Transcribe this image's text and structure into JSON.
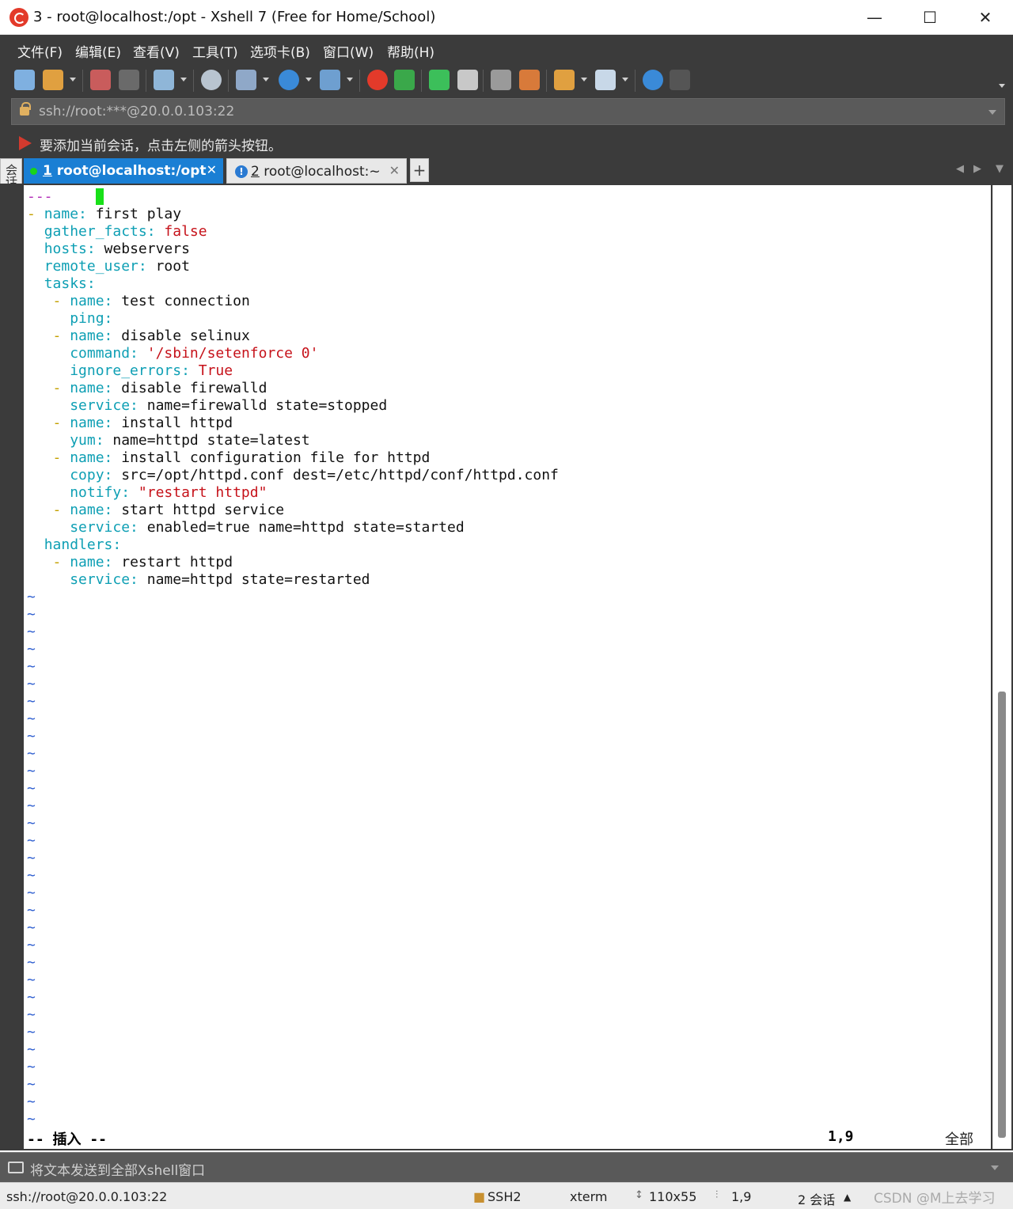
{
  "window": {
    "title": "3 - root@localhost:/opt - Xshell 7 (Free for Home/School)",
    "minimize": "—",
    "maximize": "☐",
    "close": "✕"
  },
  "menu": [
    "文件(F)",
    "编辑(E)",
    "查看(V)",
    "工具(T)",
    "选项卡(B)",
    "窗口(W)",
    "帮助(H)"
  ],
  "toolbar": {
    "icons": [
      "new-session-icon",
      "open-folder-icon",
      "reconnect-icon",
      "disconnect-icon",
      "new-tab-icon",
      "find-icon",
      "transfer-icon",
      "globe-icon",
      "font-icon",
      "xshell-icon",
      "xftp-icon",
      "fullscreen-icon",
      "lock-icon",
      "keyboard-icon",
      "highlight-icon",
      "new-folder-icon",
      "layout-icon",
      "help-icon",
      "chat-icon"
    ]
  },
  "address": {
    "value": "ssh://root:***@20.0.0.103:22"
  },
  "hint": {
    "text": "要添加当前会话，点击左侧的箭头按钮。"
  },
  "side_manager": {
    "label": "会话管理器"
  },
  "tabs": [
    {
      "number": "1",
      "label": "root@localhost:/opt",
      "close": "✕",
      "active": true,
      "status_color": "#19d419"
    },
    {
      "number": "2",
      "label": "root@localhost:~",
      "close": "✕",
      "active": false,
      "status_color": "#2a7ad2"
    }
  ],
  "tab_add": "+",
  "terminal": {
    "lines": [
      "---",
      "- name: first play",
      "  gather_facts: false",
      "  hosts: webservers",
      "  remote_user: root",
      "  tasks:",
      "   - name: test connection",
      "     ping:",
      "   - name: disable selinux",
      "     command: '/sbin/setenforce 0'",
      "     ignore_errors: True",
      "   - name: disable firewalld",
      "     service: name=firewalld state=stopped",
      "   - name: install httpd",
      "     yum: name=httpd state=latest",
      "   - name: install configuration file for httpd",
      "     copy: src=/opt/httpd.conf dest=/etc/httpd/conf/httpd.conf",
      "     notify: \"restart httpd\"",
      "   - name: start httpd service",
      "     service: enabled=true name=httpd state=started",
      "  handlers:",
      "   - name: restart httpd",
      "     service: name=httpd state=restarted"
    ],
    "tilde_count": 31,
    "tilde": "~",
    "mode": "-- 插入 --",
    "position": "1,9",
    "scroll_label": "全部",
    "colors": {
      "key": "#0e9fb4",
      "string": "#c6121a",
      "dash": "#c4a000",
      "doc_marker": "#b22cb8",
      "tilde": "#2f5fd0",
      "cursor": "#18e018"
    }
  },
  "sendbar": {
    "text": "将文本发送到全部Xshell窗口"
  },
  "statusbar": {
    "connection": "ssh://root@20.0.0.103:22",
    "protocol": "SSH2",
    "terminal_type": "xterm",
    "size": "110x55",
    "cursor_pos": "1,9",
    "sessions": "2 会话",
    "watermark": "CSDN @M上去学习"
  }
}
